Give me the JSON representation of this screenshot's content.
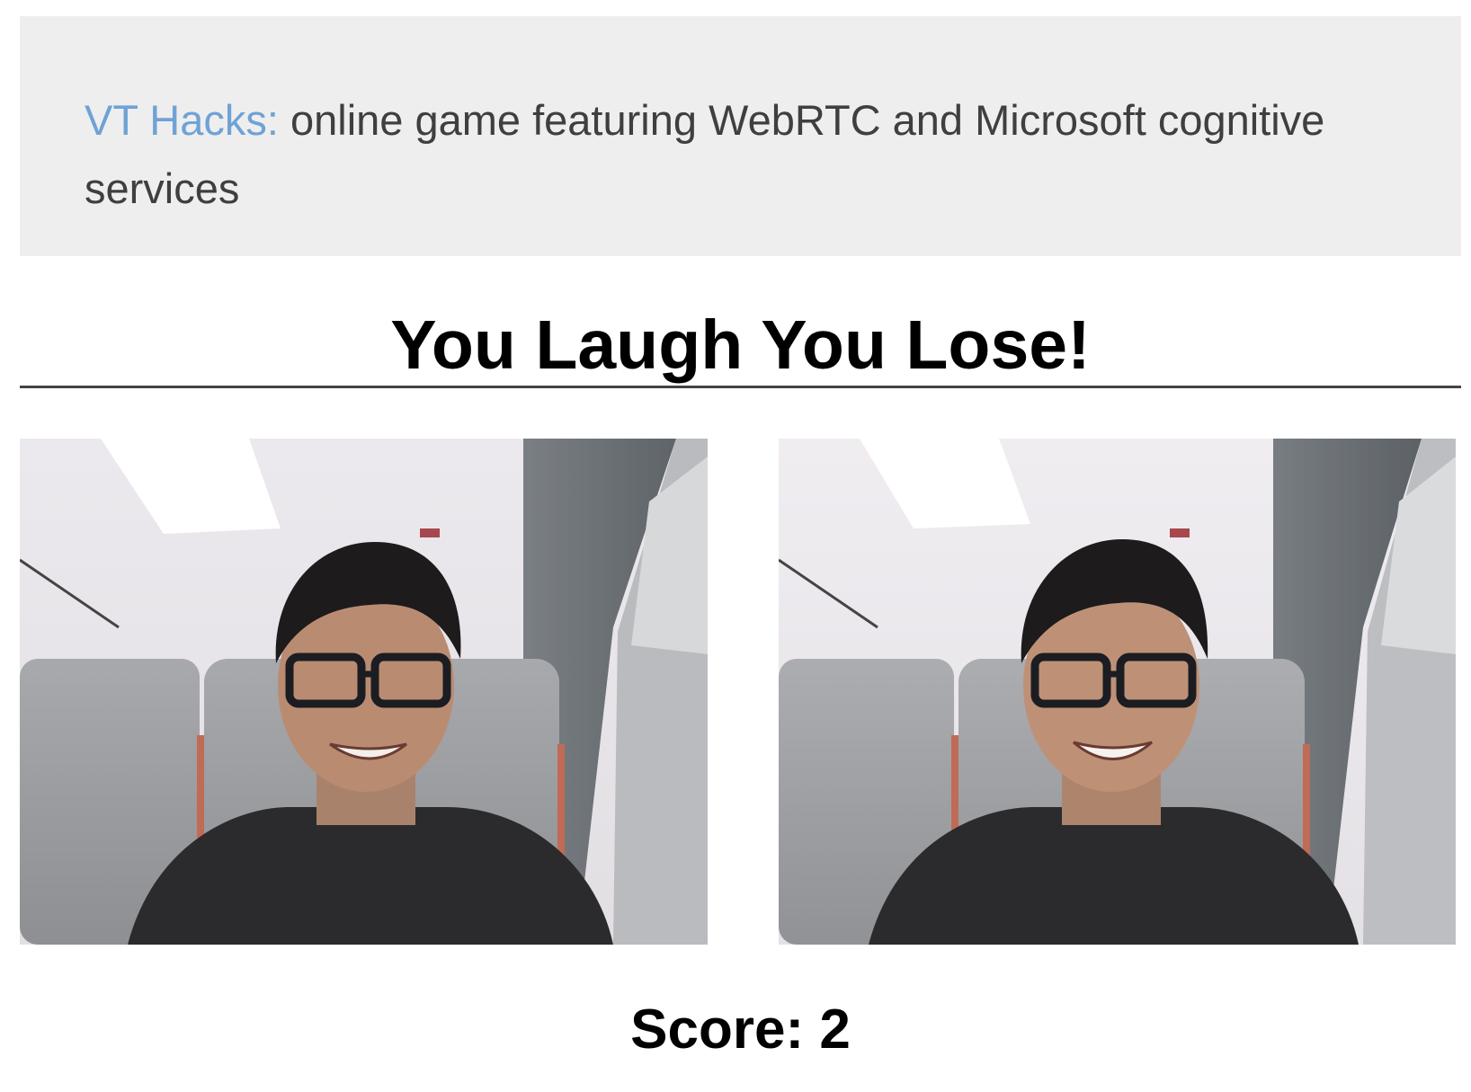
{
  "banner": {
    "brand": "VT Hacks:",
    "description": "online game featuring WebRTC and Microsoft cognitive services"
  },
  "game": {
    "title": "You Laugh You Lose!",
    "score_label": "Score:",
    "score_value": "2"
  },
  "videos": [
    {
      "id": "local",
      "subject": "webcam feed of smiling person with glasses"
    },
    {
      "id": "remote",
      "subject": "webcam feed of smiling person with glasses"
    }
  ],
  "colors": {
    "brand_link": "#6fa2d6",
    "banner_bg": "#eeeeee",
    "banner_text": "#3f3f3f",
    "title": "#000000"
  }
}
